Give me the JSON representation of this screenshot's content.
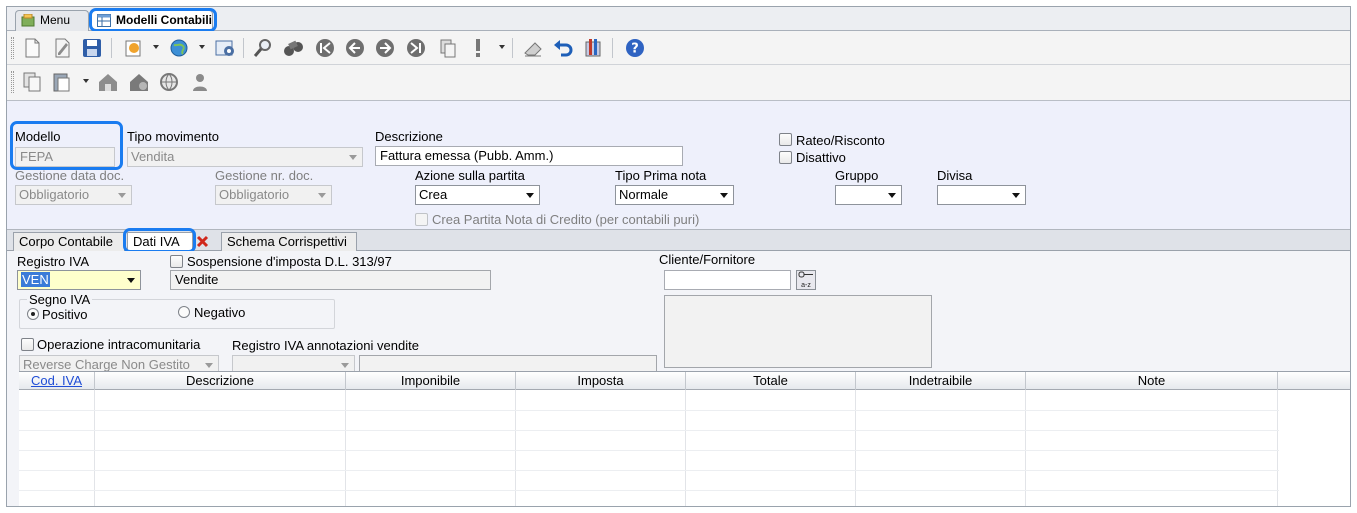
{
  "tabs": [
    {
      "label": "Menu"
    },
    {
      "label": "Modelli Contabili"
    }
  ],
  "form": {
    "modello_label": "Modello",
    "modello_value": "FEPA",
    "tipo_movimento_label": "Tipo movimento",
    "tipo_movimento_value": "Vendita",
    "descrizione_label": "Descrizione",
    "descrizione_value": "Fattura emessa (Pubb. Amm.)",
    "rateo_label": "Rateo/Risconto",
    "disattivo_label": "Disattivo",
    "gestione_data_label": "Gestione data doc.",
    "gestione_data_value": "Obbligatorio",
    "gestione_nr_label": "Gestione nr. doc.",
    "gestione_nr_value": "Obbligatorio",
    "azione_label": "Azione sulla partita",
    "azione_value": "Crea",
    "tipo_prima_nota_label": "Tipo Prima nota",
    "tipo_prima_nota_value": "Normale",
    "gruppo_label": "Gruppo",
    "gruppo_value": "",
    "divisa_label": "Divisa",
    "divisa_value": "",
    "crea_partita_label": "Crea Partita Nota di Credito (per contabili puri)"
  },
  "inner_tabs": [
    {
      "label": "Corpo Contabile"
    },
    {
      "label": "Dati IVA"
    },
    {
      "label": "Schema Corrispettivi"
    }
  ],
  "iva": {
    "registro_label": "Registro IVA",
    "registro_value": "VEN",
    "sospensione_label": "Sospensione d'imposta D.L. 313/97",
    "registro_desc": "Vendite",
    "cliente_label": "Cliente/Fornitore",
    "cliente_value": "",
    "segno_label": "Segno IVA",
    "positivo_label": "Positivo",
    "negativo_label": "Negativo",
    "operazione_label": "Operazione intracomunitaria",
    "reverse_value": "Reverse Charge Non Gestito",
    "registro_annot_label": "Registro IVA annotazioni vendite",
    "registro_annot_value": ""
  },
  "grid": {
    "columns": [
      "Cod. IVA",
      "Descrizione",
      "Imponibile",
      "Imposta",
      "Totale",
      "Indetraibile",
      "Note"
    ],
    "rows": []
  },
  "colors": {
    "focus_ring": "#1a7cf0",
    "form_bg": "#eef0fb",
    "highlight_field": "#ffffcc",
    "selection": "#3b7bd8",
    "link": "#1f4dd6"
  },
  "icons": {
    "toolbar_row_1": [
      "new-doc-icon",
      "edit-icon",
      "save-icon",
      "insert-icon",
      "globe-icon",
      "settings-icon",
      "search-icon",
      "binoculars-icon",
      "first-icon",
      "prev-icon",
      "next-icon",
      "last-icon",
      "copy-icon",
      "exclamation-icon",
      "clear-icon",
      "undo-icon",
      "tools-icon",
      "help-icon"
    ],
    "toolbar_row_2": [
      "copy-doc-icon",
      "paste-icon",
      "home-icon",
      "home-alt-icon",
      "globe-nav-icon",
      "user-icon"
    ]
  }
}
